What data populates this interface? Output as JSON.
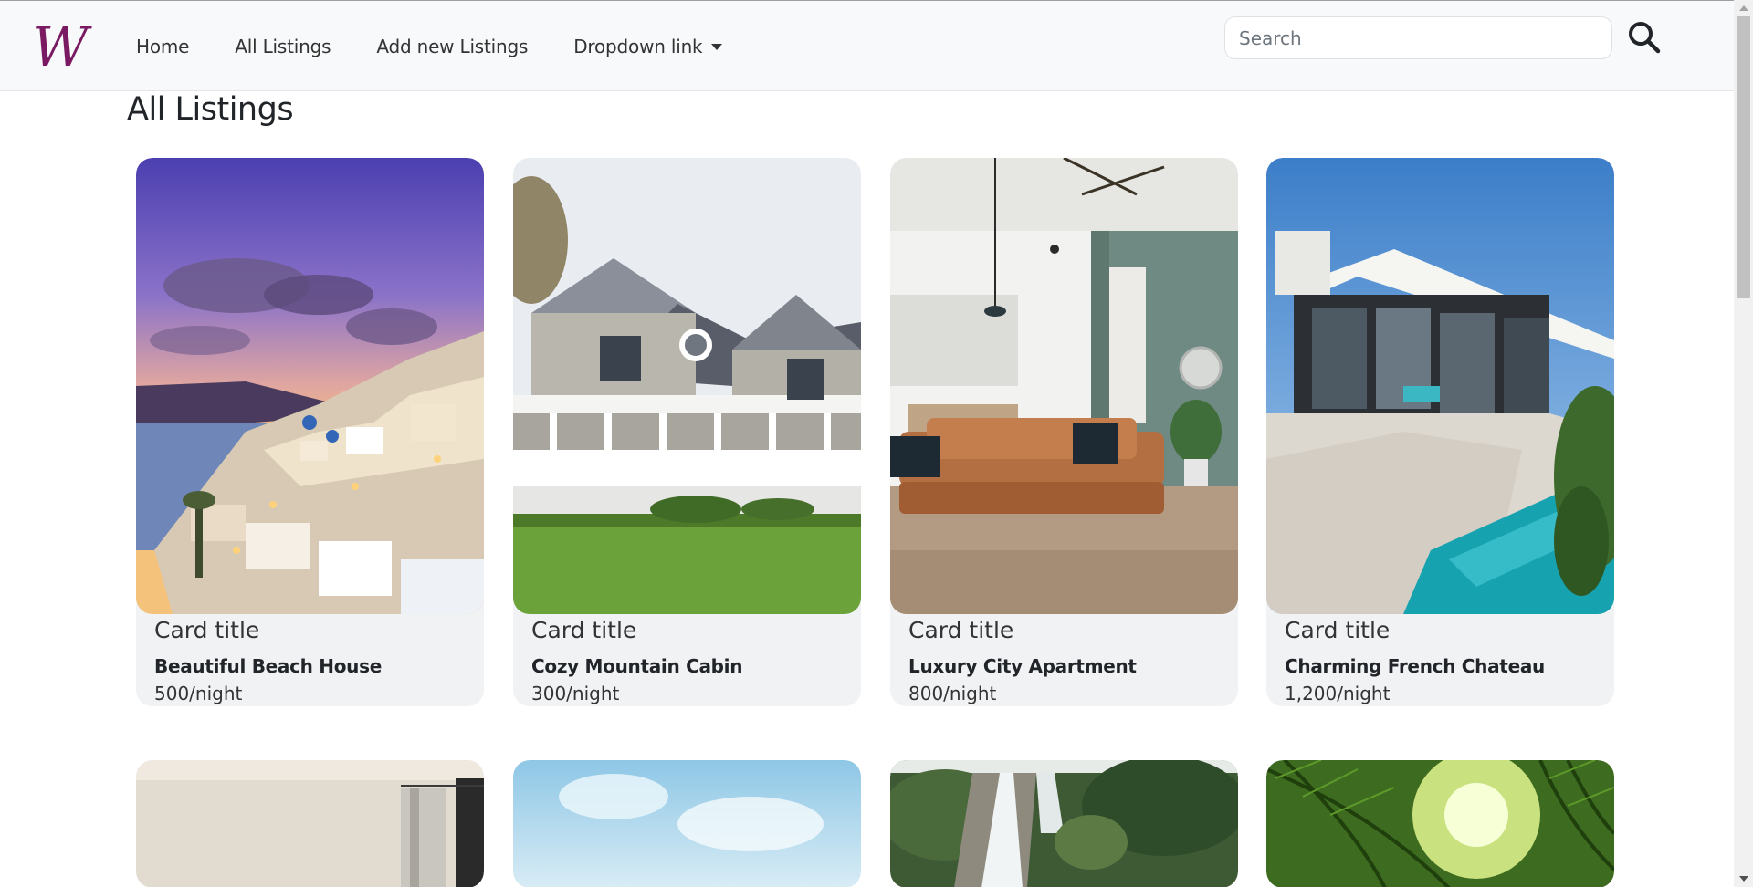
{
  "navbar": {
    "brand_icon": "w-logo-icon",
    "links": [
      {
        "label": "Home"
      },
      {
        "label": "All Listings"
      },
      {
        "label": "Add new Listings"
      },
      {
        "label": "Dropdown link"
      }
    ],
    "search": {
      "placeholder": "Search",
      "value": ""
    },
    "search_icon": "search-icon"
  },
  "page": {
    "title": "All Listings"
  },
  "listings": [
    {
      "card_title": "Card title",
      "name": "Beautiful Beach House",
      "price": "500/night",
      "image": "santorini-sunset"
    },
    {
      "card_title": "Card title",
      "name": "Cozy Mountain Cabin",
      "price": "300/night",
      "image": "white-house-porch"
    },
    {
      "card_title": "Card title",
      "name": "Luxury City Apartment",
      "price": "800/night",
      "image": "living-room-sofa"
    },
    {
      "card_title": "Card title",
      "name": "Charming French Chateau",
      "price": "1,200/night",
      "image": "modern-villa-pool"
    },
    {
      "image": "bedroom-window"
    },
    {
      "image": "blue-sky"
    },
    {
      "image": "waterfall"
    },
    {
      "image": "palm-leaves"
    }
  ],
  "colors": {
    "brand": "#7a1a63",
    "navbar_bg": "#f8f9fa",
    "card_bg": "#f1f2f4"
  }
}
